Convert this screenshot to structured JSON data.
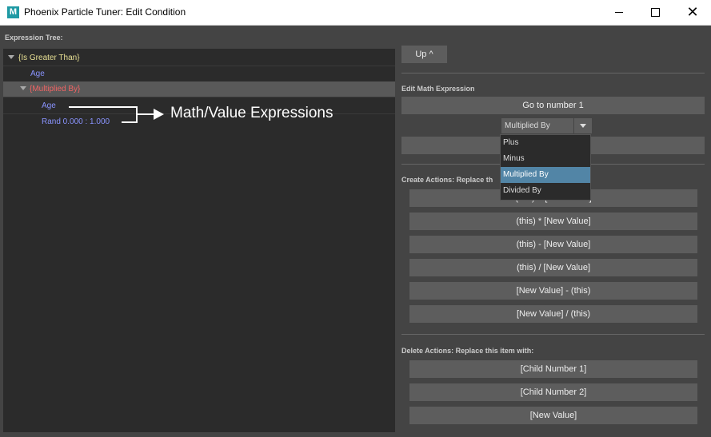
{
  "window": {
    "icon_letter": "M",
    "title": "Phoenix Particle Tuner: Edit Condition",
    "close_glyph": "✕"
  },
  "tree": {
    "label": "Expression Tree:",
    "rows": [
      "{Is Greater Than}",
      "Age",
      "{Multiplied By}",
      "Age",
      "Rand 0.000 : 1.000"
    ]
  },
  "annotation": {
    "text": "Math/Value Expressions"
  },
  "up_button": "Up ^",
  "edit_math": {
    "label": "Edit Math Expression",
    "goto_button": "Go to number 1",
    "dropdown_value": "Multiplied By",
    "dropdown_options": [
      "Plus",
      "Minus",
      "Multiplied By",
      "Divided By"
    ],
    "selected_option": "Multiplied By"
  },
  "create_actions": {
    "label": "Create Actions: Replace th",
    "buttons": [
      "(this) + [New Value]",
      "(this) * [New Value]",
      "(this) - [New Value]",
      "(this) / [New Value]",
      "[New Value] - (this)",
      "[New Value] / (this)"
    ]
  },
  "delete_actions": {
    "label": "Delete Actions: Replace this item with:",
    "buttons": [
      "[Child Number 1]",
      "[Child Number 2]",
      "[New Value]"
    ]
  },
  "colors": {
    "operator": "#e8e094",
    "value": "#8a94ff",
    "selected_operator": "#f06464",
    "selection": "#5285a6"
  }
}
